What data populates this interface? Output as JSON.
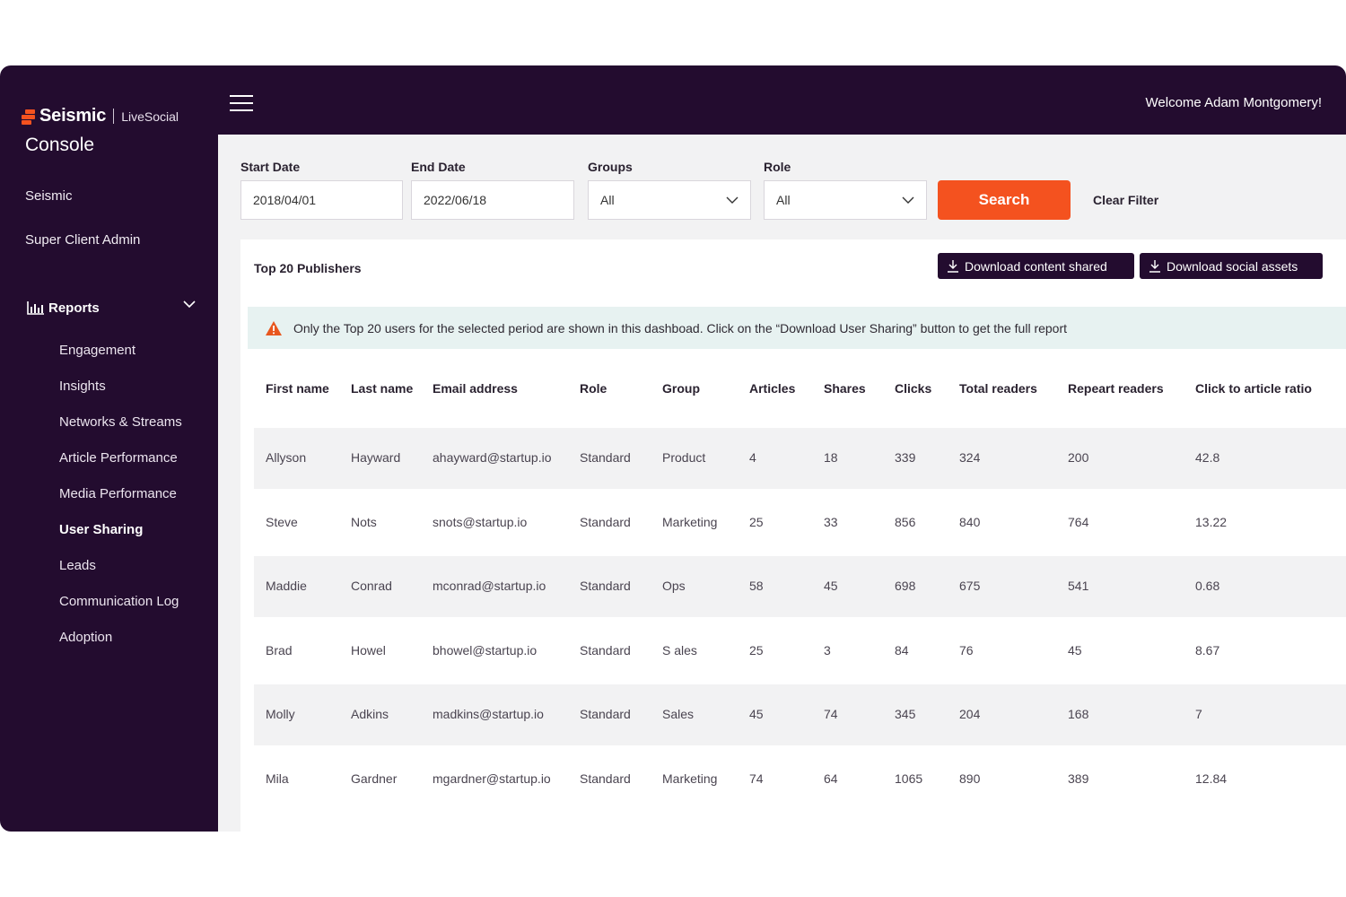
{
  "app": {
    "brand": "Seismic",
    "product": "LiveSocial",
    "console": "Console",
    "welcome": "Welcome Adam Montgomery!"
  },
  "sidebar": {
    "items": [
      "Seismic",
      "Super Client Admin"
    ],
    "reports_label": "Reports",
    "sub_items": [
      "Engagement",
      "Insights",
      "Networks & Streams",
      "Article Performance",
      "Media Performance",
      "User Sharing",
      "Leads",
      "Communication Log",
      "Adoption"
    ],
    "active": "User Sharing"
  },
  "filters": {
    "start_label": "Start Date",
    "start_value": "2018/04/01",
    "end_label": "End Date",
    "end_value": "2022/06/18",
    "groups_label": "Groups",
    "groups_value": "All",
    "role_label": "Role",
    "role_value": "All",
    "search_label": "Search",
    "clear_label": "Clear Filter"
  },
  "panel": {
    "title": "Top 20 Publishers",
    "download_content": "Download content shared",
    "download_assets": "Download social assets",
    "alert": "Only the Top 20 users for the selected period are shown in this dashboad. Click on the “Download User Sharing” button to get the full report"
  },
  "table": {
    "columns": [
      "First name",
      "Last name",
      "Email address",
      "Role",
      "Group",
      "Articles",
      "Shares",
      "Clicks",
      "Total readers",
      "Repeart readers",
      "Click to article ratio"
    ],
    "rows": [
      [
        "Allyson",
        "Hayward",
        "ahayward@startup.io",
        "Standard",
        "Product",
        "4",
        "18",
        "339",
        "324",
        "200",
        "42.8"
      ],
      [
        "Steve",
        "Nots",
        "snots@startup.io",
        "Standard",
        "Marketing",
        "25",
        "33",
        "856",
        "840",
        "764",
        "13.22"
      ],
      [
        "Maddie",
        "Conrad",
        "mconrad@startup.io",
        "Standard",
        "Ops",
        "58",
        "45",
        "698",
        "675",
        "541",
        "0.68"
      ],
      [
        "Brad",
        "Howel",
        "bhowel@startup.io",
        "Standard",
        "S ales",
        "25",
        "3",
        "84",
        "76",
        "45",
        "8.67"
      ],
      [
        "Molly",
        "Adkins",
        "madkins@startup.io",
        "Standard",
        "Sales",
        "45",
        "74",
        "345",
        "204",
        "168",
        "7"
      ],
      [
        "Mila",
        "Gardner",
        "mgardner@startup.io",
        "Standard",
        "Marketing",
        "74",
        "64",
        "1065",
        "890",
        "389",
        "12.84"
      ]
    ]
  },
  "colors": {
    "sidebar_bg": "#230c2f",
    "accent": "#f4521f",
    "alert_bg": "#e7f2f1",
    "warning": "#e8571f"
  }
}
